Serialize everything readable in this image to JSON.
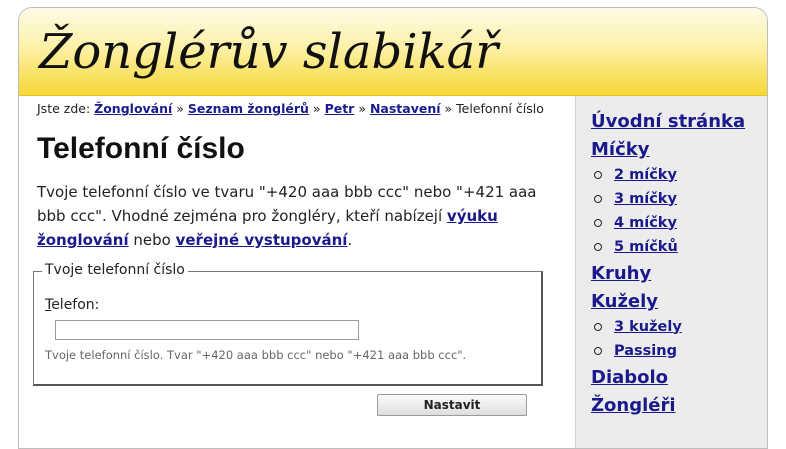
{
  "site": {
    "logo_text": "Žonglérův slabikář"
  },
  "breadcrumb": {
    "prefix": "Jste zde:",
    "items": [
      "Žonglování",
      "Seznam žonglérů",
      "Petr",
      "Nastavení"
    ],
    "separator": "»",
    "current": "Telefonní číslo"
  },
  "page": {
    "title": "Telefonní číslo",
    "intro_text1": "Tvoje telefonní číslo ve tvaru \"+420 aaa bbb ccc\" nebo \"+421 aaa bbb ccc\". Vhodné zejména pro žongléry, kteří nabízejí ",
    "intro_link1": "výuku žonglování",
    "intro_text2": " nebo ",
    "intro_link2": "veřejné vystupování",
    "intro_text3": "."
  },
  "form": {
    "legend": "Tvoje telefonní číslo",
    "label_accesskey": "T",
    "label_rest": "elefon:",
    "input_value": "",
    "hint": "Tvoje telefonní číslo. Tvar \"+420 aaa bbb ccc\" nebo \"+421 aaa bbb ccc\".",
    "submit_label": "Nastavit"
  },
  "sidebar": {
    "items": [
      {
        "label": "Úvodní stránka"
      },
      {
        "label": "Míčky",
        "children": [
          "2 míčky",
          "3 míčky",
          "4 míčky",
          "5 míčků"
        ]
      },
      {
        "label": "Kruhy"
      },
      {
        "label": "Kužely",
        "children": [
          "3 kužely",
          "Passing"
        ]
      },
      {
        "label": "Diabolo"
      },
      {
        "label": "Žongléři"
      }
    ]
  },
  "colors": {
    "link": "#1a1a8c",
    "header_gradient_top": "#fdfbe6",
    "header_gradient_bottom": "#f6d735",
    "sidebar_bg": "#ececec"
  }
}
